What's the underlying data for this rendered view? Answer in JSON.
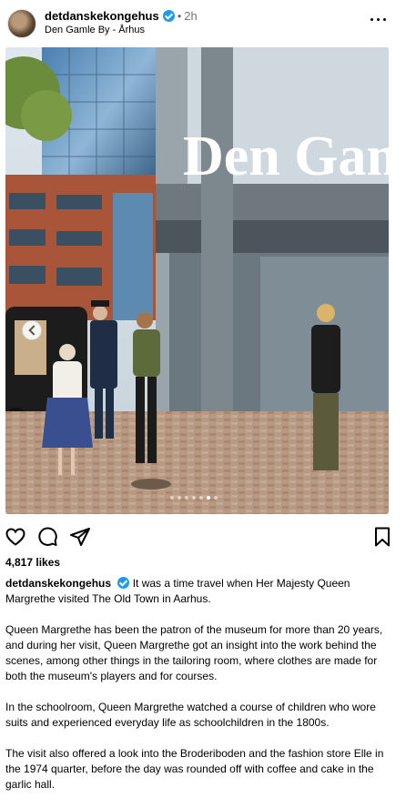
{
  "post": {
    "username": "detdanskekongehus",
    "separator": "•",
    "time": "2h",
    "location": "Den Gamle By - Århus"
  },
  "photo": {
    "sign_text": "Den Gaml",
    "slide_count": 7,
    "active_slide": 6
  },
  "likes": "4,817 likes",
  "caption": {
    "username": "detdanskekongehus",
    "first_line": "It was a time travel when Her Majesty Queen Margrethe visited The Old Town in Aarhus.",
    "paragraphs": [
      "Queen Margrethe has been the patron of the museum for more than 20 years, and during her visit, Queen Margrethe got an insight into the work behind the scenes, among other things in the tailoring room, where clothes are made for both the museum's players and for courses.",
      "In the schoolroom, Queen Margrethe watched a course of children who wore suits and experienced everyday life as schoolchildren in the 1800s.",
      "The visit also offered a look into the Broderiboden and the fashion store Elle in the 1974 quarter, before the day was rounded off with coffee and cake in the garlic hall."
    ]
  },
  "icons": {
    "verified": "verified-badge-icon",
    "like": "heart-icon",
    "comment": "comment-icon",
    "share": "send-icon",
    "save": "bookmark-icon",
    "more": "more-options-icon",
    "prev": "chevron-left-icon"
  }
}
